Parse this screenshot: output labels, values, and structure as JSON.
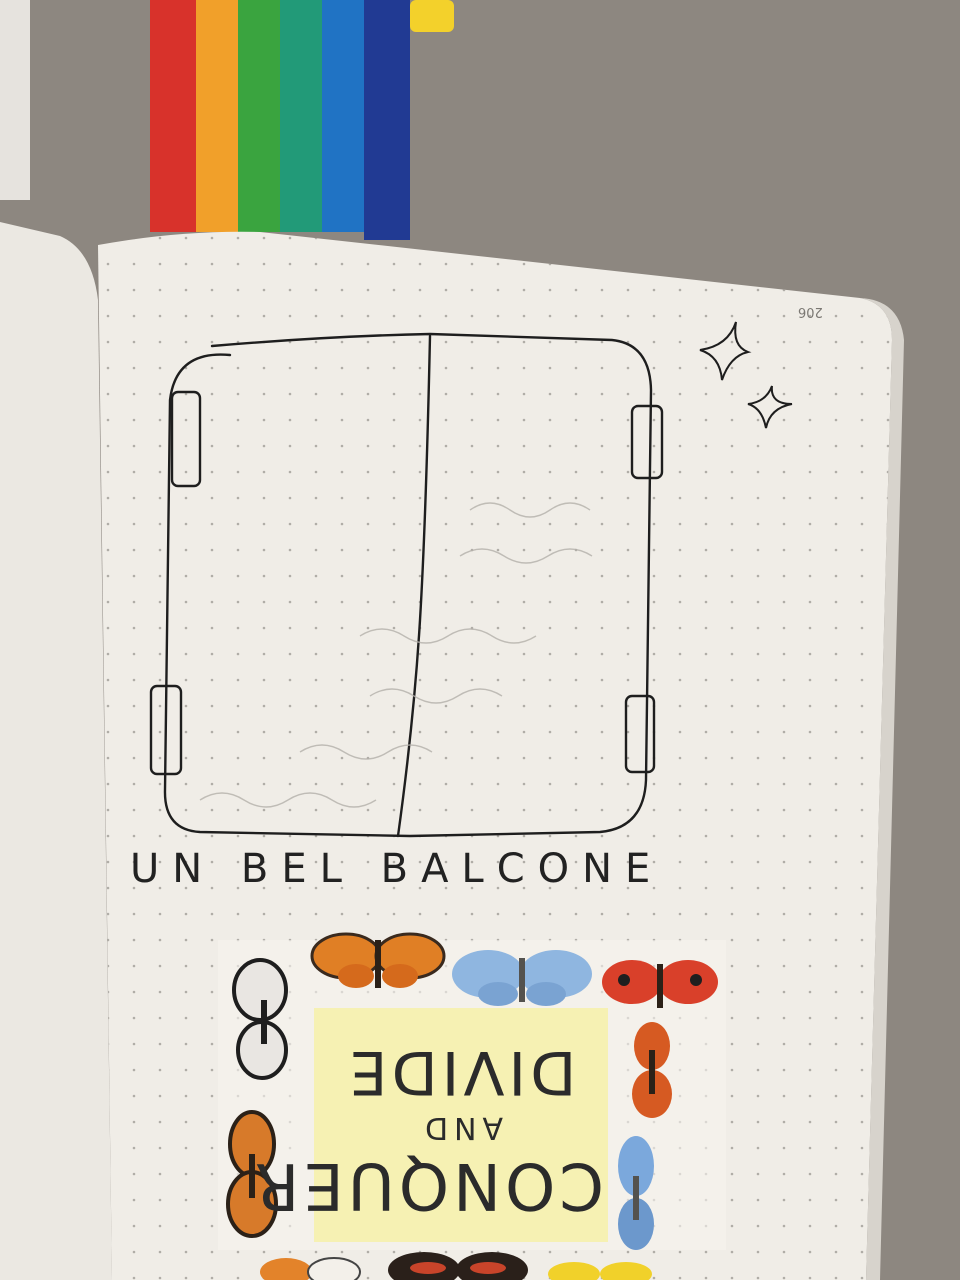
{
  "scene": {
    "background": "#8d8780",
    "rainbow_colors": [
      "#d8322b",
      "#f1a02a",
      "#3aa43f",
      "#229a78",
      "#2073c4",
      "#213a93"
    ]
  },
  "notebook": {
    "page_number": "206",
    "caption": "UN BEL BALCONE",
    "sticky_note": {
      "line1": "CONQUER",
      "line2": "AND",
      "line3": "DIVIDE"
    }
  },
  "icons": [
    "sparkle-icon",
    "butterfly-icon"
  ]
}
